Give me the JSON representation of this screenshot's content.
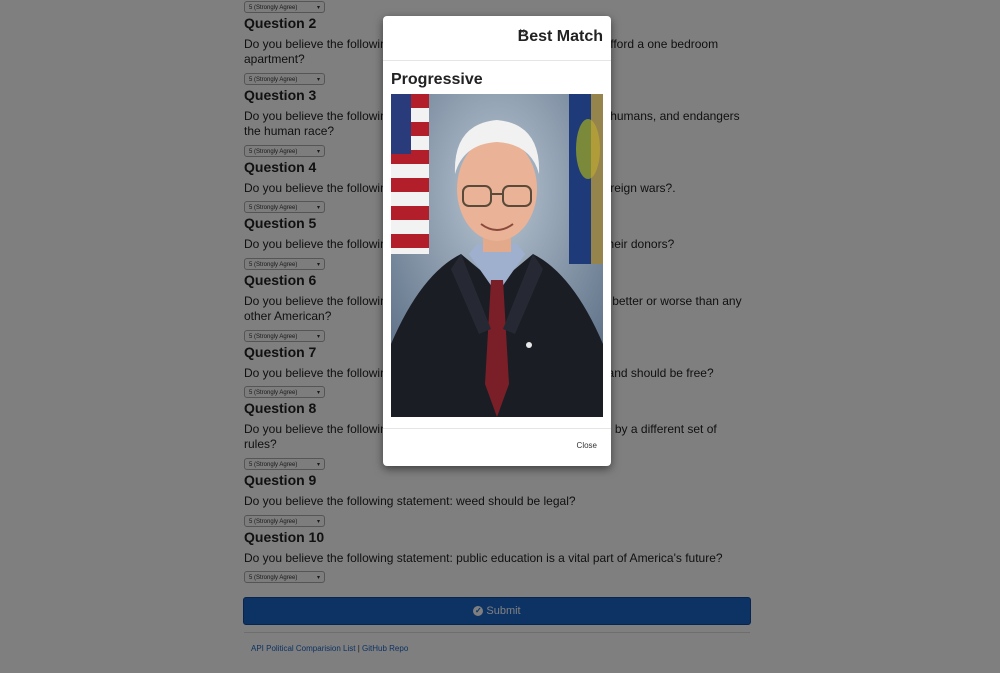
{
  "select_value": "5 (Strongly Agree)",
  "questions": [
    {
      "title": "Question 2",
      "text": "Do you believe the following statement: everyone should be able to afford a one bedroom apartment?"
    },
    {
      "title": "Question 3",
      "text": "Do you believe the following statement: climate change is caused by humans, and endangers the human race?"
    },
    {
      "title": "Question 4",
      "text": "Do you believe the following statement: America should stay out of foreign wars?."
    },
    {
      "title": "Question 5",
      "text": "Do you believe the following statement: politicians are controlled by their donors?"
    },
    {
      "title": "Question 6",
      "text": "Do you believe the following statement: members of congress are no better or worse than any other American?"
    },
    {
      "title": "Question 7",
      "text": "Do you believe the following statement: health care is a human right and should be free?"
    },
    {
      "title": "Question 8",
      "text": "Do you believe the following statement: the rich and powerful operate by a different set of rules?"
    },
    {
      "title": "Question 9",
      "text": "Do you believe the following statement: weed should be legal?"
    },
    {
      "title": "Question 10",
      "text": "Do you believe the following statement: public education is a vital part of America's future?"
    }
  ],
  "submit_label": "Submit",
  "footer": {
    "link1": "API Political Comparision List",
    "sep": "|",
    "link2": "GitHub Repo"
  },
  "modal": {
    "title": "Best Match",
    "close_x": "×",
    "subtitle": "Progressive",
    "close_label": "Close"
  },
  "colors": {
    "primary": "#1a64c8",
    "overlay": "rgba(0,0,0,0.5)"
  }
}
